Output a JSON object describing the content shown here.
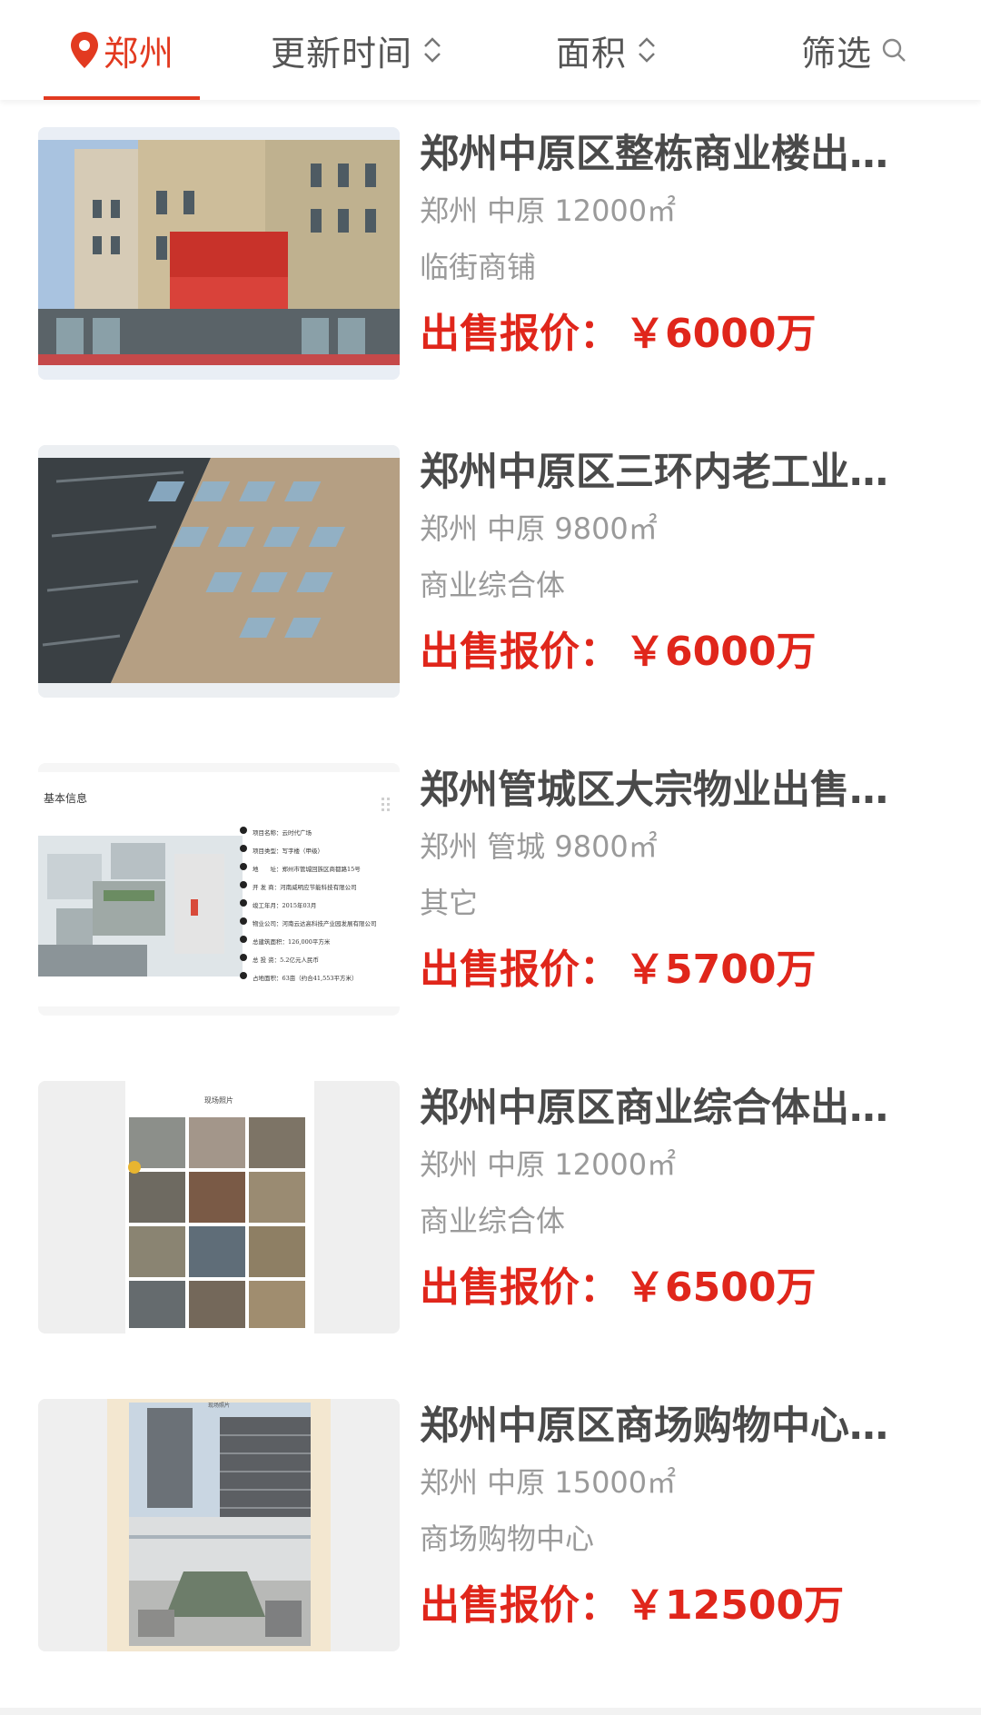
{
  "filter_bar": {
    "city": "郑州",
    "update_time": "更新时间",
    "area": "面积",
    "filter": "筛选"
  },
  "colors": {
    "accent": "#e23a20",
    "price": "#e0261b"
  },
  "listings": [
    {
      "title": "郑州中原区整栋商业楼出…",
      "meta": "郑州 中原 12000㎡",
      "type": "临街商铺",
      "price_label": "出售报价：",
      "price": "￥6000万"
    },
    {
      "title": "郑州中原区三环内老工业…",
      "meta": "郑州 中原 9800㎡",
      "type": "商业综合体",
      "price_label": "出售报价：",
      "price": "￥6000万"
    },
    {
      "title": "郑州管城区大宗物业出售…",
      "meta": "郑州 管城 9800㎡",
      "type": "其它",
      "price_label": "出售报价：",
      "price": "￥5700万",
      "image_text": {
        "heading": "基本信息",
        "rows": [
          "项目名称：云时代广场",
          "项目类型：写字楼（甲级）",
          "地　　址：郑州市管城回族区商都路15号",
          "开 发 商：河南威明应节能科技有限公司",
          "竣工年月：2015年03月",
          "物业公司：河南云达高科技产业园发展有限公司",
          "总建筑面积：126,000平方米",
          "总 投 资：5.2亿元人民币",
          "占地面积：63亩（约合41,553平方米）"
        ]
      }
    },
    {
      "title": "郑州中原区商业综合体出…",
      "meta": "郑州 中原 12000㎡",
      "type": "商业综合体",
      "price_label": "出售报价：",
      "price": "￥6500万",
      "image_text": {
        "heading": "现场照片"
      }
    },
    {
      "title": "郑州中原区商场购物中心…",
      "meta": "郑州 中原 15000㎡",
      "type": "商场购物中心",
      "price_label": "出售报价：",
      "price": "￥12500万",
      "image_text": {
        "heading": "现场照片"
      }
    }
  ]
}
